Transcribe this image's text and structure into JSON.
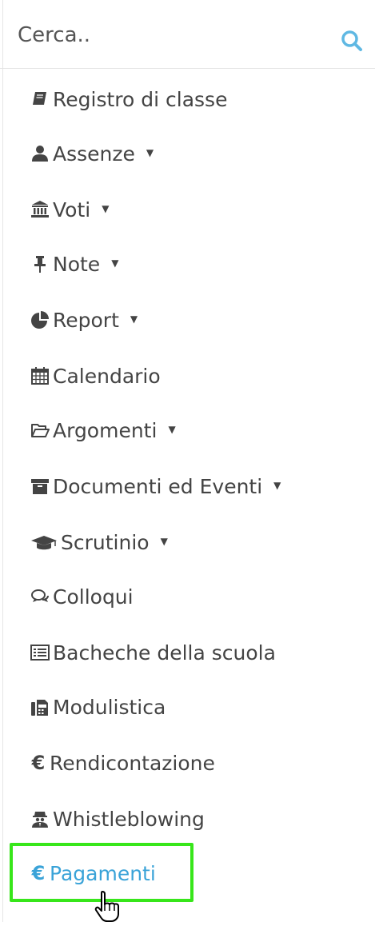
{
  "search": {
    "placeholder": "Cerca..",
    "icon": "search-icon"
  },
  "menu": {
    "items": [
      {
        "label": "Registro di classe",
        "icon": "book-icon",
        "dropdown": false
      },
      {
        "label": "Assenze",
        "icon": "user-icon",
        "dropdown": true
      },
      {
        "label": "Voti",
        "icon": "bank-icon",
        "dropdown": true
      },
      {
        "label": "Note",
        "icon": "pushpin-icon",
        "dropdown": true
      },
      {
        "label": "Report",
        "icon": "pie-chart-icon",
        "dropdown": true
      },
      {
        "label": "Calendario",
        "icon": "calendar-icon",
        "dropdown": false
      },
      {
        "label": "Argomenti",
        "icon": "folder-open-icon",
        "dropdown": true
      },
      {
        "label": "Documenti ed Eventi",
        "icon": "archive-icon",
        "dropdown": true
      },
      {
        "label": "Scrutinio",
        "icon": "graduation-cap-icon",
        "dropdown": true
      },
      {
        "label": "Colloqui",
        "icon": "comments-icon",
        "dropdown": false
      },
      {
        "label": "Bacheche della scuola",
        "icon": "list-alt-icon",
        "dropdown": false
      },
      {
        "label": "Modulistica",
        "icon": "fax-icon",
        "dropdown": false
      },
      {
        "label": "Rendicontazione",
        "icon": "euro-icon",
        "dropdown": false
      },
      {
        "label": "Whistleblowing",
        "icon": "user-secret-icon",
        "dropdown": false
      },
      {
        "label": "Pagamenti",
        "icon": "euro-icon",
        "dropdown": false,
        "active": true
      }
    ],
    "caret": "▼",
    "euro_glyph": "€"
  },
  "colors": {
    "accent": "#3aa3d8",
    "highlight": "#37e61a",
    "text": "#444444"
  }
}
